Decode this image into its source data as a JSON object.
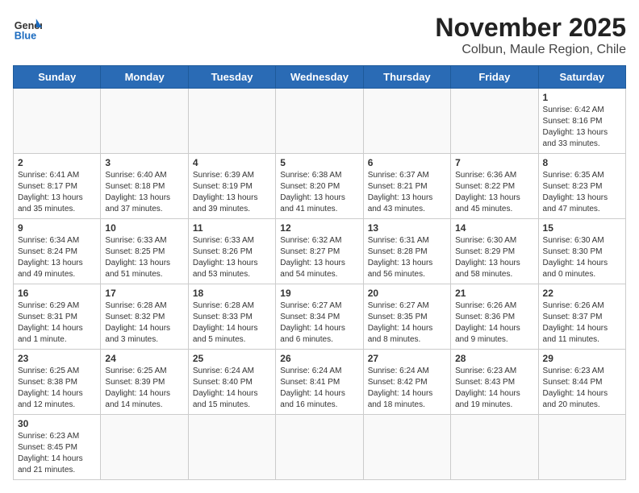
{
  "logo": {
    "text_general": "General",
    "text_blue": "Blue"
  },
  "title": {
    "month_year": "November 2025",
    "location": "Colbun, Maule Region, Chile"
  },
  "weekdays": [
    "Sunday",
    "Monday",
    "Tuesday",
    "Wednesday",
    "Thursday",
    "Friday",
    "Saturday"
  ],
  "weeks": [
    [
      {
        "day": "",
        "info": ""
      },
      {
        "day": "",
        "info": ""
      },
      {
        "day": "",
        "info": ""
      },
      {
        "day": "",
        "info": ""
      },
      {
        "day": "",
        "info": ""
      },
      {
        "day": "",
        "info": ""
      },
      {
        "day": "1",
        "info": "Sunrise: 6:42 AM\nSunset: 8:16 PM\nDaylight: 13 hours and 33 minutes."
      }
    ],
    [
      {
        "day": "2",
        "info": "Sunrise: 6:41 AM\nSunset: 8:17 PM\nDaylight: 13 hours and 35 minutes."
      },
      {
        "day": "3",
        "info": "Sunrise: 6:40 AM\nSunset: 8:18 PM\nDaylight: 13 hours and 37 minutes."
      },
      {
        "day": "4",
        "info": "Sunrise: 6:39 AM\nSunset: 8:19 PM\nDaylight: 13 hours and 39 minutes."
      },
      {
        "day": "5",
        "info": "Sunrise: 6:38 AM\nSunset: 8:20 PM\nDaylight: 13 hours and 41 minutes."
      },
      {
        "day": "6",
        "info": "Sunrise: 6:37 AM\nSunset: 8:21 PM\nDaylight: 13 hours and 43 minutes."
      },
      {
        "day": "7",
        "info": "Sunrise: 6:36 AM\nSunset: 8:22 PM\nDaylight: 13 hours and 45 minutes."
      },
      {
        "day": "8",
        "info": "Sunrise: 6:35 AM\nSunset: 8:23 PM\nDaylight: 13 hours and 47 minutes."
      }
    ],
    [
      {
        "day": "9",
        "info": "Sunrise: 6:34 AM\nSunset: 8:24 PM\nDaylight: 13 hours and 49 minutes."
      },
      {
        "day": "10",
        "info": "Sunrise: 6:33 AM\nSunset: 8:25 PM\nDaylight: 13 hours and 51 minutes."
      },
      {
        "day": "11",
        "info": "Sunrise: 6:33 AM\nSunset: 8:26 PM\nDaylight: 13 hours and 53 minutes."
      },
      {
        "day": "12",
        "info": "Sunrise: 6:32 AM\nSunset: 8:27 PM\nDaylight: 13 hours and 54 minutes."
      },
      {
        "day": "13",
        "info": "Sunrise: 6:31 AM\nSunset: 8:28 PM\nDaylight: 13 hours and 56 minutes."
      },
      {
        "day": "14",
        "info": "Sunrise: 6:30 AM\nSunset: 8:29 PM\nDaylight: 13 hours and 58 minutes."
      },
      {
        "day": "15",
        "info": "Sunrise: 6:30 AM\nSunset: 8:30 PM\nDaylight: 14 hours and 0 minutes."
      }
    ],
    [
      {
        "day": "16",
        "info": "Sunrise: 6:29 AM\nSunset: 8:31 PM\nDaylight: 14 hours and 1 minute."
      },
      {
        "day": "17",
        "info": "Sunrise: 6:28 AM\nSunset: 8:32 PM\nDaylight: 14 hours and 3 minutes."
      },
      {
        "day": "18",
        "info": "Sunrise: 6:28 AM\nSunset: 8:33 PM\nDaylight: 14 hours and 5 minutes."
      },
      {
        "day": "19",
        "info": "Sunrise: 6:27 AM\nSunset: 8:34 PM\nDaylight: 14 hours and 6 minutes."
      },
      {
        "day": "20",
        "info": "Sunrise: 6:27 AM\nSunset: 8:35 PM\nDaylight: 14 hours and 8 minutes."
      },
      {
        "day": "21",
        "info": "Sunrise: 6:26 AM\nSunset: 8:36 PM\nDaylight: 14 hours and 9 minutes."
      },
      {
        "day": "22",
        "info": "Sunrise: 6:26 AM\nSunset: 8:37 PM\nDaylight: 14 hours and 11 minutes."
      }
    ],
    [
      {
        "day": "23",
        "info": "Sunrise: 6:25 AM\nSunset: 8:38 PM\nDaylight: 14 hours and 12 minutes."
      },
      {
        "day": "24",
        "info": "Sunrise: 6:25 AM\nSunset: 8:39 PM\nDaylight: 14 hours and 14 minutes."
      },
      {
        "day": "25",
        "info": "Sunrise: 6:24 AM\nSunset: 8:40 PM\nDaylight: 14 hours and 15 minutes."
      },
      {
        "day": "26",
        "info": "Sunrise: 6:24 AM\nSunset: 8:41 PM\nDaylight: 14 hours and 16 minutes."
      },
      {
        "day": "27",
        "info": "Sunrise: 6:24 AM\nSunset: 8:42 PM\nDaylight: 14 hours and 18 minutes."
      },
      {
        "day": "28",
        "info": "Sunrise: 6:23 AM\nSunset: 8:43 PM\nDaylight: 14 hours and 19 minutes."
      },
      {
        "day": "29",
        "info": "Sunrise: 6:23 AM\nSunset: 8:44 PM\nDaylight: 14 hours and 20 minutes."
      }
    ],
    [
      {
        "day": "30",
        "info": "Sunrise: 6:23 AM\nSunset: 8:45 PM\nDaylight: 14 hours and 21 minutes."
      },
      {
        "day": "",
        "info": ""
      },
      {
        "day": "",
        "info": ""
      },
      {
        "day": "",
        "info": ""
      },
      {
        "day": "",
        "info": ""
      },
      {
        "day": "",
        "info": ""
      },
      {
        "day": "",
        "info": ""
      }
    ]
  ]
}
